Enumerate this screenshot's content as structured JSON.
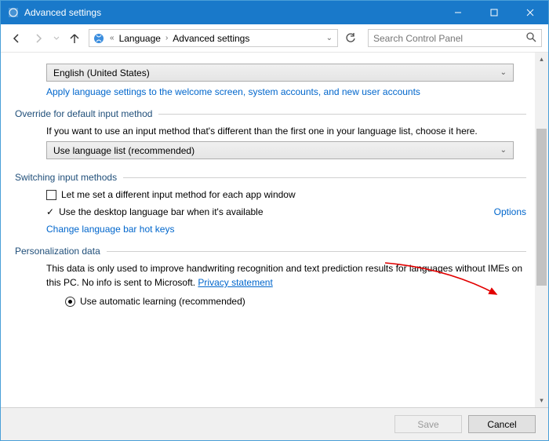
{
  "window": {
    "title": "Advanced settings"
  },
  "breadcrumb": {
    "root_chevron": "«",
    "item1": "Language",
    "item2": "Advanced settings"
  },
  "search": {
    "placeholder": "Search Control Panel"
  },
  "dropdown1": {
    "value": "English (United States)"
  },
  "link_apply": "Apply language settings to the welcome screen, system accounts, and new user accounts",
  "section_override": {
    "title": "Override for default input method",
    "desc": "If you want to use an input method that's different than the first one in your language list, choose it here.",
    "dropdown_value": "Use language list (recommended)"
  },
  "section_switch": {
    "title": "Switching input methods",
    "cb1_label": "Let me set a different input method for each app window",
    "cb2_label": "Use the desktop language bar when it's available",
    "options_label": "Options",
    "hotkeys_link": "Change language bar hot keys"
  },
  "section_personalization": {
    "title": "Personalization data",
    "desc_prefix": "This data is only used to improve handwriting recognition and text prediction results for languages without IMEs on this PC. No info is sent to Microsoft. ",
    "privacy_link": "Privacy statement",
    "radio1_label": "Use automatic learning (recommended)"
  },
  "footer": {
    "save": "Save",
    "cancel": "Cancel"
  }
}
